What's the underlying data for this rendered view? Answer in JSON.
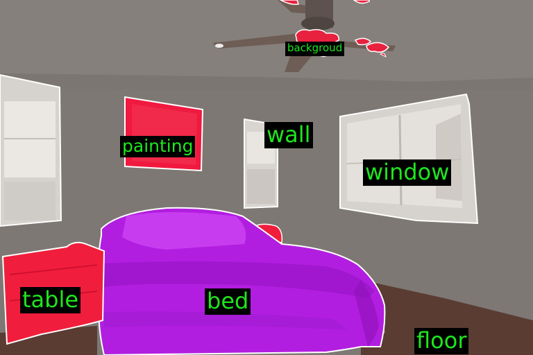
{
  "segments": [
    {
      "id": "backgroud",
      "label": "backgroud",
      "color": "#e8213f"
    },
    {
      "id": "wall",
      "label": "wall",
      "color": "#8a8580"
    },
    {
      "id": "painting",
      "label": "painting",
      "color": "#f0193f"
    },
    {
      "id": "window",
      "label": "window",
      "color": "#dcd8d3"
    },
    {
      "id": "bed",
      "label": "bed",
      "color": "#b21ee0"
    },
    {
      "id": "table",
      "label": "table",
      "color": "#f01e3c"
    },
    {
      "id": "floor",
      "label": "floor",
      "color": "#5a3c33"
    }
  ],
  "label_style": {
    "text_color": "#1ee61e",
    "background": "#000000"
  }
}
